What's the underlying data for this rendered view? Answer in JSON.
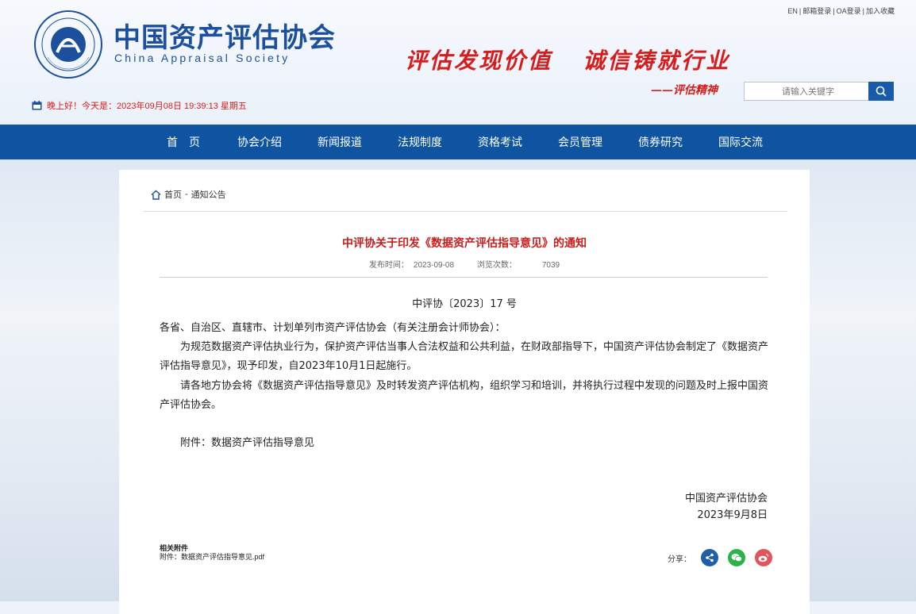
{
  "header": {
    "site_name": "中国资产评估协会",
    "site_name_en": "China Appraisal Society",
    "logo_text": "China Appraisal Society",
    "slogan": "评估发现价值   诚信铸就行业",
    "slogan_sub": "——评估精神",
    "top_links": [
      "EN",
      "邮箱登录",
      "OA登录",
      "加入收藏"
    ],
    "search_placeholder": "请输入关键字",
    "greeting": "晚上好！今天是：2023年09月08日 19:39:13 星期五"
  },
  "nav": {
    "items": [
      "首　页",
      "协会介绍",
      "新闻报道",
      "法规制度",
      "资格考试",
      "会员管理",
      "债券研究",
      "国际交流"
    ]
  },
  "breadcrumb": {
    "home": "首页",
    "sep": "-",
    "current": "通知公告"
  },
  "article": {
    "title": "中评协关于印发《数据资产评估指导意见》的通知",
    "date_label": "发布时间：",
    "date": "2023-09-08",
    "views_label": "浏览次数：",
    "views": "7039",
    "doc_no": "中评协〔2023〕17 号",
    "salutation": "各省、自治区、直辖市、计划单列市资产评估协会（有关注册会计师协会）：",
    "p1": "为规范数据资产评估执业行为，保护资产评估当事人合法权益和公共利益，在财政部指导下，中国资产评估协会制定了《数据资产评估指导意见》，现予印发，自2023年10月1日起施行。",
    "p2": "请各地方协会将《数据资产评估指导意见》及时转发资产评估机构，组织学习和培训，并将执行过程中发现的问题及时上报中国资产评估协会。",
    "attachment_line": "附件：数据资产评估指导意见",
    "signer": "中国资产评估协会",
    "sign_date": "2023年9月8日",
    "related_heading": "相关附件",
    "related_file": "附件：数据资产评估指导意见.pdf",
    "share_label": "分享："
  },
  "colors": {
    "brand_blue": "#0e54a1",
    "accent_red": "#c81e1e",
    "wechat_green": "#2bb34a",
    "weibo_red": "#e0545a",
    "share_blue": "#1f5fa8"
  }
}
